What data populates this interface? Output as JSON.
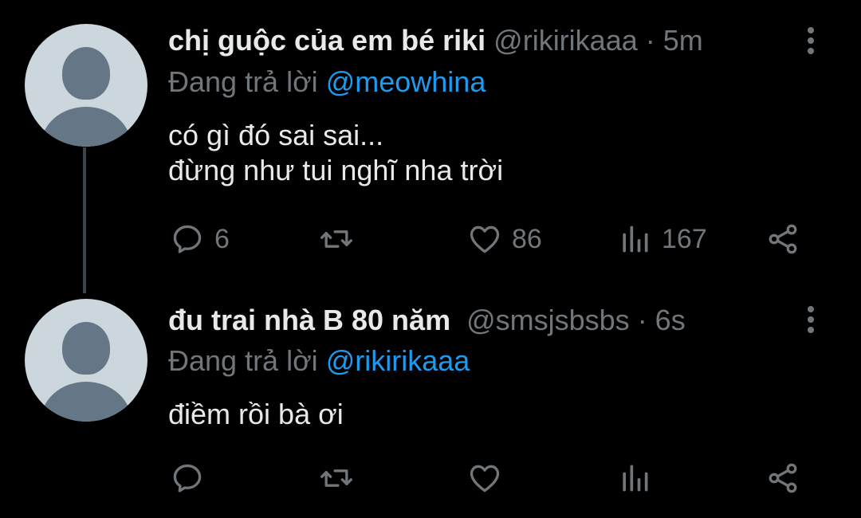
{
  "tweets": [
    {
      "display_name": "chị guộc của em bé riki",
      "handle": "@rikirikaaa",
      "time": "· 5m",
      "reply_prefix": "Đang trả lời",
      "reply_to": "@meowhina",
      "text_line1": "có gì đó sai sai...",
      "text_line2": "đừng như tui nghĩ nha trời",
      "replies": "6",
      "retweets": "",
      "likes": "86",
      "views": "167"
    },
    {
      "display_name": "đu trai nhà B 80 năm",
      "handle": "@smsjsbsbs",
      "time": "· 6s",
      "reply_prefix": "Đang trả lời",
      "reply_to": "@rikirikaaa",
      "text_line1": "điềm rồi bà ơi",
      "replies": "",
      "retweets": "",
      "likes": "",
      "views": ""
    }
  ],
  "colors": {
    "background": "#000000",
    "text": "#e7e9ea",
    "muted": "#71767b",
    "link": "#1d9bf0",
    "avatar_bg": "#ccd6dd",
    "avatar_fg": "#657786"
  },
  "icons": [
    "reply-icon",
    "retweet-icon",
    "like-icon",
    "views-icon",
    "share-icon",
    "more-icon"
  ]
}
